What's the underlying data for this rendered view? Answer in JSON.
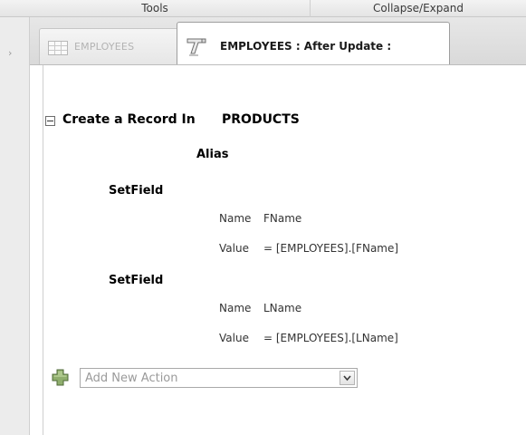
{
  "ribbon": {
    "groups": [
      {
        "label": "Tools"
      },
      {
        "label": "Collapse/Expand"
      }
    ]
  },
  "nav": {
    "expand_glyph": "›"
  },
  "tabs": [
    {
      "label": "EMPLOYEES",
      "icon": "table-icon",
      "active": false
    },
    {
      "label": "EMPLOYEES : After Update :",
      "icon": "data-macro-icon",
      "active": true
    }
  ],
  "macro": {
    "block_label": "Create a Record In",
    "block_target": "PRODUCTS",
    "alias_label": "Alias",
    "actions": [
      {
        "label": "SetField",
        "name_label": "Name",
        "name_value": "FName",
        "value_label": "Value",
        "value_value": "= [EMPLOYEES].[FName]"
      },
      {
        "label": "SetField",
        "name_label": "Name",
        "name_value": "LName",
        "value_label": "Value",
        "value_value": "= [EMPLOYEES].[LName]"
      }
    ],
    "add_action": {
      "placeholder": "Add New Action",
      "icon": "add-plus-icon"
    }
  },
  "colors": {
    "plus_icon": "#7a9a5a",
    "border": "#a9a9a9"
  }
}
